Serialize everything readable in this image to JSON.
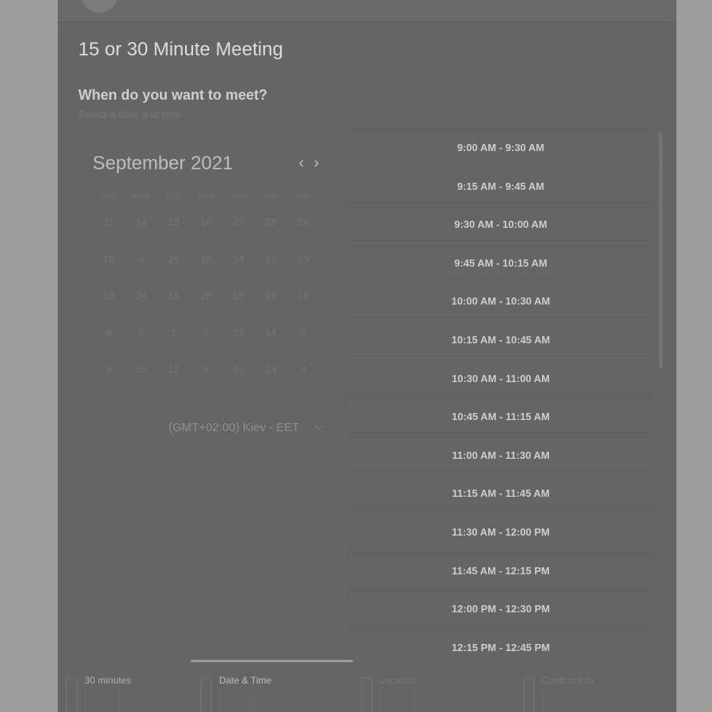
{
  "app": {
    "title": "15 or 30 Minute Meeting"
  },
  "header": {
    "question": "When do you want to meet?",
    "subtitle": "Select a date and time"
  },
  "calendar": {
    "month_label": "September 2021",
    "prev_icon": "chevron-left-icon",
    "next_icon": "chevron-right-icon",
    "weekdays": [
      "SUN",
      "MON",
      "TUE",
      "WED",
      "THU",
      "FRI",
      "SAT"
    ],
    "weeks": [
      [
        "21",
        "14",
        "13",
        "16",
        "27",
        "28",
        "26"
      ],
      [
        "18",
        "4",
        "25",
        "18",
        "24",
        "17",
        "13"
      ],
      [
        "13",
        "24",
        "15",
        "28",
        "18",
        "19",
        "10"
      ],
      [
        "6",
        "7",
        "1",
        "8",
        "22",
        "14",
        "9"
      ],
      [
        "4",
        "15",
        "12",
        "3",
        "10",
        "13",
        "8"
      ]
    ]
  },
  "timezone": {
    "selected": "(GMT+02:00) Kiev - EET",
    "icon": "chevron-down-icon"
  },
  "time_slots": [
    "9:00 AM - 9:30 AM",
    "9:15 AM - 9:45 AM",
    "9:30 AM - 10:00 AM",
    "9:45 AM - 10:15 AM",
    "10:00 AM - 10:30 AM",
    "10:15 AM - 10:45 AM",
    "10:30 AM - 11:00 AM",
    "10:45 AM - 11:15 AM",
    "11:00 AM - 11:30 AM",
    "11:15 AM - 11:45 AM",
    "11:30 AM - 12:00 PM",
    "11:45 AM - 12:15 PM",
    "12:00 PM - 12:30 PM",
    "12:15 PM - 12:45 PM"
  ],
  "steps": [
    {
      "label": "30 minutes",
      "active": false,
      "done": true
    },
    {
      "label": "Date & Time",
      "active": true,
      "done": false
    },
    {
      "label": "Location",
      "active": false,
      "done": false
    },
    {
      "label": "Confirm Info",
      "active": false,
      "done": false
    }
  ],
  "colors": {
    "backdrop": "#9d9d9d",
    "panel": "#656565",
    "text_strong": "#dcdcdc",
    "text_muted": "#767676",
    "progress": "#9b9b9b"
  }
}
